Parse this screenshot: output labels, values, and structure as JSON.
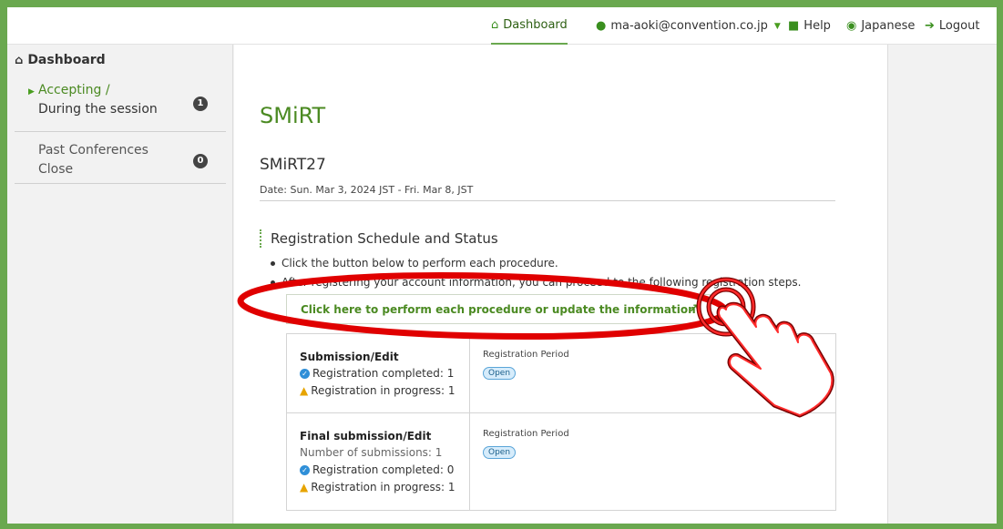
{
  "topnav": {
    "dashboard": "Dashboard",
    "user_email": "ma-aoki@convention.co.jp",
    "help": "Help",
    "language": "Japanese",
    "logout": "Logout"
  },
  "sidebar": {
    "title": "Dashboard",
    "items": [
      {
        "line1": "Accepting /",
        "line2": "During the session",
        "count": "1"
      },
      {
        "line1": "Past Conferences",
        "line2": "Close",
        "count": "0"
      }
    ]
  },
  "conference": {
    "name": "SMiRT",
    "edition": "SMiRT27",
    "date": "Date: Sun. Mar 3, 2024 JST - Fri. Mar 8, JST"
  },
  "registration": {
    "heading": "Registration Schedule and Status",
    "bullets": [
      "Click the button below to perform each procedure.",
      "After registering your account information, you can proceed to the following registration steps."
    ],
    "action_label": "Click here to perform each procedure or update the information",
    "rows": [
      {
        "name": "Submission/Edit",
        "submissions": "",
        "completed": "Registration completed: 1",
        "in_progress": "Registration in progress: 1",
        "period_label": "Registration Period",
        "status": "Open"
      },
      {
        "name": "Final submission/Edit",
        "submissions": "Number of submissions: 1",
        "completed": "Registration completed: 0",
        "in_progress": "Registration in progress: 1",
        "period_label": "Registration Period",
        "status": "Open"
      }
    ]
  },
  "colors": {
    "brand_green": "#6aa84f",
    "title_green": "#4b8a22",
    "annotation_red": "#e00000"
  }
}
